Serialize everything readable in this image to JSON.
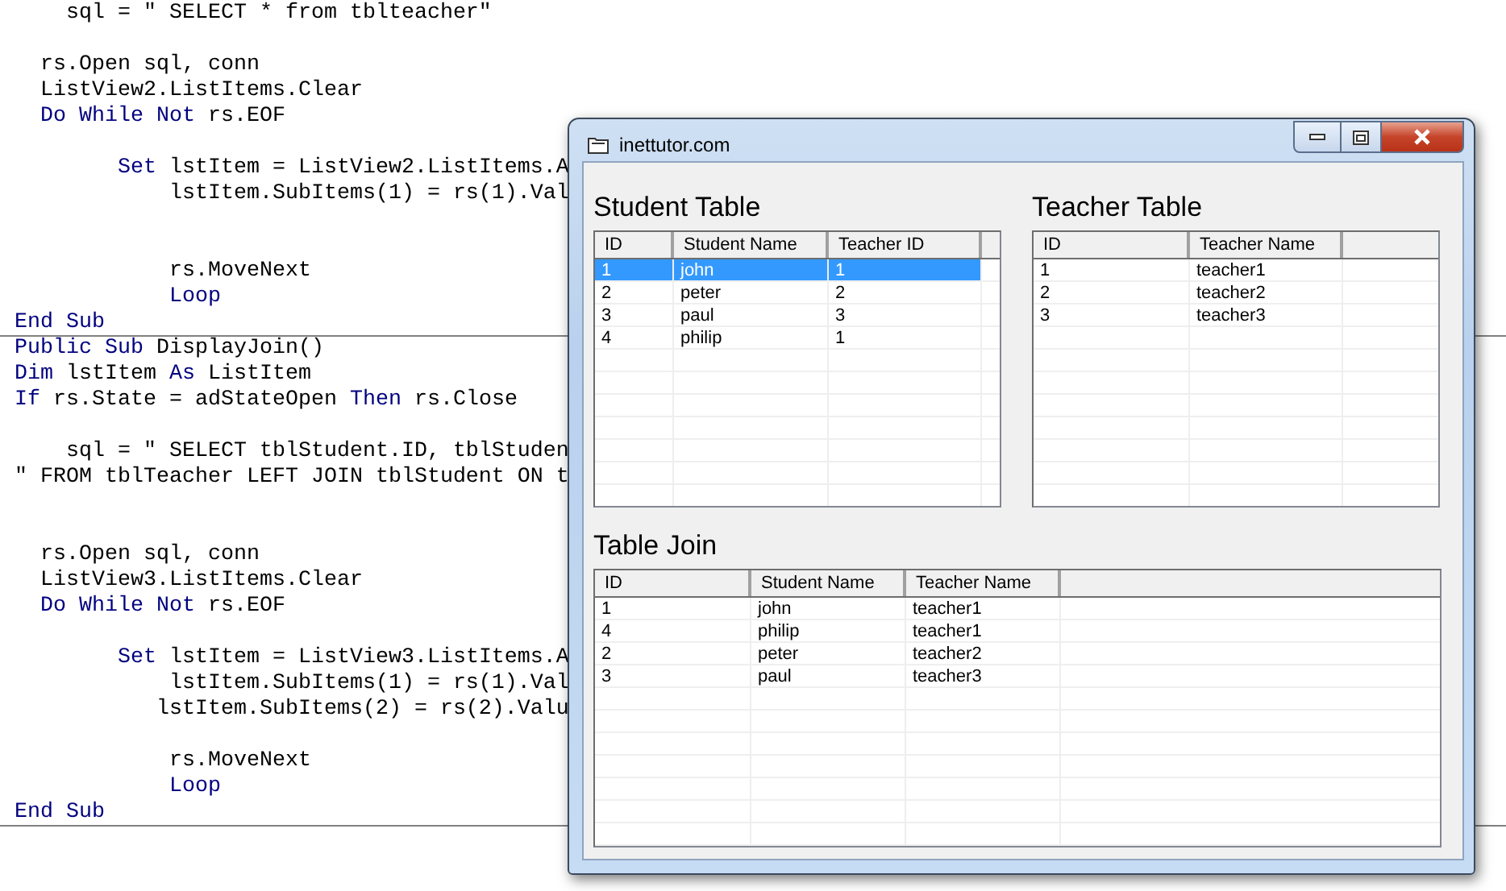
{
  "code_lines": [
    {
      "kind": "code",
      "divider": false,
      "segments": [
        {
          "text": "    sql = \" SELECT * from tblteacher\"",
          "kind": "plain"
        }
      ]
    },
    {
      "kind": "blank"
    },
    {
      "kind": "code",
      "divider": false,
      "segments": [
        {
          "text": "  rs.Open sql, conn",
          "kind": "plain"
        }
      ]
    },
    {
      "kind": "code",
      "divider": false,
      "segments": [
        {
          "text": "  ListView2.ListItems.Clear",
          "kind": "plain"
        }
      ]
    },
    {
      "kind": "code",
      "divider": false,
      "segments": [
        {
          "text": "  Do While Not",
          "kind": "keyword"
        },
        {
          "text": " rs.EOF",
          "kind": "plain"
        }
      ]
    },
    {
      "kind": "blank"
    },
    {
      "kind": "code",
      "divider": false,
      "segments": [
        {
          "text": "        Set",
          "kind": "keyword"
        },
        {
          "text": " lstItem = ListView2.ListItems.A",
          "kind": "plain"
        }
      ]
    },
    {
      "kind": "code",
      "divider": false,
      "segments": [
        {
          "text": "            lstItem.SubItems(1) = rs(1).Val",
          "kind": "plain"
        }
      ]
    },
    {
      "kind": "blank"
    },
    {
      "kind": "blank"
    },
    {
      "kind": "code",
      "divider": false,
      "segments": [
        {
          "text": "            rs.MoveNext",
          "kind": "plain"
        }
      ]
    },
    {
      "kind": "code",
      "divider": false,
      "segments": [
        {
          "text": "            Loop",
          "kind": "keyword"
        }
      ]
    },
    {
      "kind": "code",
      "divider": true,
      "segments": [
        {
          "text": "End Sub",
          "kind": "keyword"
        }
      ]
    },
    {
      "kind": "code",
      "divider": false,
      "segments": [
        {
          "text": "Public Sub",
          "kind": "keyword"
        },
        {
          "text": " DisplayJoin()",
          "kind": "plain"
        }
      ]
    },
    {
      "kind": "code",
      "divider": false,
      "segments": [
        {
          "text": "Dim",
          "kind": "keyword"
        },
        {
          "text": " lstItem ",
          "kind": "plain"
        },
        {
          "text": "As",
          "kind": "keyword"
        },
        {
          "text": " ListItem",
          "kind": "plain"
        }
      ]
    },
    {
      "kind": "code",
      "divider": false,
      "segments": [
        {
          "text": "If",
          "kind": "keyword"
        },
        {
          "text": " rs.State = adStateOpen ",
          "kind": "plain"
        },
        {
          "text": "Then",
          "kind": "keyword"
        },
        {
          "text": " rs.Close",
          "kind": "plain"
        }
      ]
    },
    {
      "kind": "blank"
    },
    {
      "kind": "code",
      "divider": false,
      "segments": [
        {
          "text": "    sql = \" SELECT tblStudent.ID, tblStuden",
          "kind": "plain"
        }
      ]
    },
    {
      "kind": "code",
      "divider": false,
      "segments": [
        {
          "text": "\" FROM tblTeacher LEFT JOIN tblStudent ON t",
          "kind": "plain"
        }
      ]
    },
    {
      "kind": "blank"
    },
    {
      "kind": "blank"
    },
    {
      "kind": "code",
      "divider": false,
      "segments": [
        {
          "text": "  rs.Open sql, conn",
          "kind": "plain"
        }
      ]
    },
    {
      "kind": "code",
      "divider": false,
      "segments": [
        {
          "text": "  ListView3.ListItems.Clear",
          "kind": "plain"
        }
      ]
    },
    {
      "kind": "code",
      "divider": false,
      "segments": [
        {
          "text": "  Do While Not",
          "kind": "keyword"
        },
        {
          "text": " rs.EOF",
          "kind": "plain"
        }
      ]
    },
    {
      "kind": "blank"
    },
    {
      "kind": "code",
      "divider": false,
      "segments": [
        {
          "text": "        Set",
          "kind": "keyword"
        },
        {
          "text": " lstItem = ListView3.ListItems.A",
          "kind": "plain"
        }
      ]
    },
    {
      "kind": "code",
      "divider": false,
      "segments": [
        {
          "text": "            lstItem.SubItems(1) = rs(1).Val",
          "kind": "plain"
        }
      ]
    },
    {
      "kind": "code",
      "divider": false,
      "segments": [
        {
          "text": "           lstItem.SubItems(2) = rs(2).Valu",
          "kind": "plain"
        }
      ]
    },
    {
      "kind": "blank"
    },
    {
      "kind": "code",
      "divider": false,
      "segments": [
        {
          "text": "            rs.MoveNext",
          "kind": "plain"
        }
      ]
    },
    {
      "kind": "code",
      "divider": false,
      "segments": [
        {
          "text": "            Loop",
          "kind": "keyword"
        }
      ]
    },
    {
      "kind": "code",
      "divider": true,
      "segments": [
        {
          "text": "End Sub",
          "kind": "keyword"
        }
      ]
    }
  ],
  "window": {
    "title": "inettutor.com",
    "tables": [
      {
        "heading": "Student Table",
        "columns": [
          "ID",
          "Student Name",
          "Teacher ID"
        ],
        "rows": [
          {
            "selected": true,
            "cells": [
              "1",
              "john",
              "1"
            ]
          },
          {
            "selected": false,
            "cells": [
              "2",
              "peter",
              "2"
            ]
          },
          {
            "selected": false,
            "cells": [
              "3",
              "paul",
              "3"
            ]
          },
          {
            "selected": false,
            "cells": [
              "4",
              "philip",
              "1"
            ]
          }
        ]
      },
      {
        "heading": "Teacher Table",
        "columns": [
          "ID",
          "Teacher Name"
        ],
        "rows": [
          {
            "selected": false,
            "cells": [
              "1",
              "teacher1"
            ]
          },
          {
            "selected": false,
            "cells": [
              "2",
              "teacher2"
            ]
          },
          {
            "selected": false,
            "cells": [
              "3",
              "teacher3"
            ]
          }
        ]
      },
      {
        "heading": "Table Join",
        "columns": [
          "ID",
          "Student Name",
          "Teacher Name"
        ],
        "rows": [
          {
            "selected": false,
            "cells": [
              "1",
              "john",
              "teacher1"
            ]
          },
          {
            "selected": false,
            "cells": [
              "4",
              "philip",
              "teacher1"
            ]
          },
          {
            "selected": false,
            "cells": [
              "2",
              "peter",
              "teacher2"
            ]
          },
          {
            "selected": false,
            "cells": [
              "3",
              "paul",
              "teacher3"
            ]
          }
        ]
      }
    ]
  }
}
